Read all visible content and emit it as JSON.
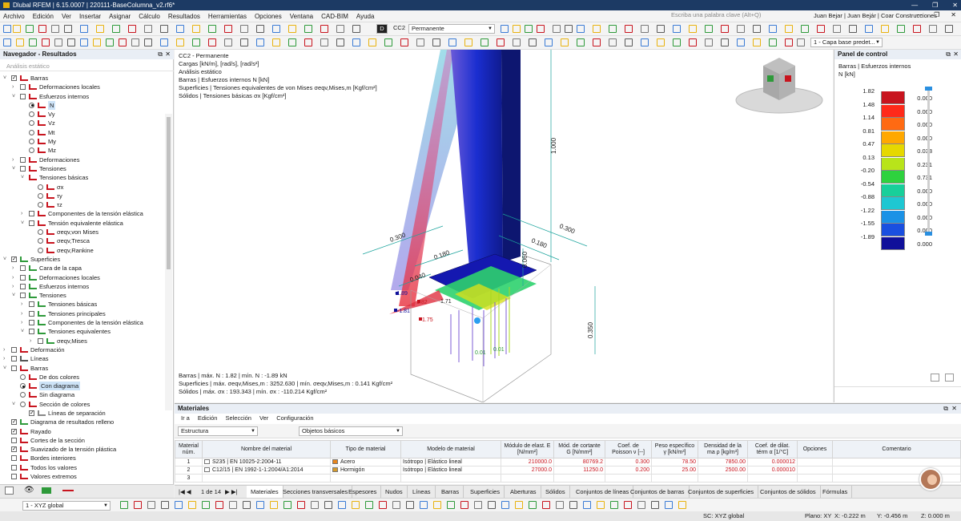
{
  "window": {
    "title": "Dlubal RFEM | 6.15.0007 | 220111-BaseColumna_v2.rf6*",
    "controls": [
      "—",
      "❐",
      "✕"
    ]
  },
  "menubar": {
    "items": [
      "Archivo",
      "Edición",
      "Ver",
      "Insertar",
      "Asignar",
      "Cálculo",
      "Resultados",
      "Herramientas",
      "Opciones",
      "Ventana",
      "CAD-BIM",
      "Ayuda"
    ],
    "search_placeholder": "Escriba una palabra clave (Alt+Q)",
    "user": "Juan Bejar | Juan Bejár | Coar Construcciones"
  },
  "toolbar": {
    "load_case_tag": "D",
    "load_case_id": "CC2",
    "load_case_name": "Permanente",
    "layer_combo": "1 - Capa base predet..."
  },
  "navigator": {
    "title": "Navegador - Resultados",
    "analysis": "Análisis estático",
    "items": [
      {
        "label": "Barras",
        "lvl": 0,
        "exp": "˅",
        "cb": "on",
        "ic": "#c8141e"
      },
      {
        "label": "Deformaciones locales",
        "lvl": 1,
        "exp": "›",
        "cb": "",
        "ic": "#c8141e"
      },
      {
        "label": "Esfuerzos internos",
        "lvl": 1,
        "exp": "˅",
        "cb": "",
        "ic": "#c8141e"
      },
      {
        "label": "N",
        "lvl": 2,
        "rb": "on",
        "ic": "#c8141e",
        "sel": true
      },
      {
        "label": "Vy",
        "lvl": 2,
        "rb": "",
        "ic": "#c8141e"
      },
      {
        "label": "Vz",
        "lvl": 2,
        "rb": "",
        "ic": "#c8141e"
      },
      {
        "label": "Mt",
        "lvl": 2,
        "rb": "",
        "ic": "#c8141e"
      },
      {
        "label": "My",
        "lvl": 2,
        "rb": "",
        "ic": "#c8141e"
      },
      {
        "label": "Mz",
        "lvl": 2,
        "rb": "",
        "ic": "#c8141e"
      },
      {
        "label": "Deformaciones",
        "lvl": 1,
        "exp": "›",
        "cb": "",
        "ic": "#c8141e"
      },
      {
        "label": "Tensiones",
        "lvl": 1,
        "exp": "˅",
        "cb": "",
        "ic": "#c8141e"
      },
      {
        "label": "Tensiones básicas",
        "lvl": 2,
        "exp": "˅",
        "ic": "#c8141e"
      },
      {
        "label": "σx",
        "lvl": 3,
        "rb": "",
        "ic": "#c8141e"
      },
      {
        "label": "τy",
        "lvl": 3,
        "rb": "",
        "ic": "#c8141e"
      },
      {
        "label": "τz",
        "lvl": 3,
        "rb": "",
        "ic": "#c8141e"
      },
      {
        "label": "Componentes de la tensión elástica",
        "lvl": 2,
        "exp": "›",
        "cb": "",
        "ic": "#c8141e"
      },
      {
        "label": "Tensión equivalente elástica",
        "lvl": 2,
        "exp": "˅",
        "cb": "",
        "ic": "#c8141e"
      },
      {
        "label": "σeqv,von Mises",
        "lvl": 3,
        "rb": "",
        "ic": "#c8141e"
      },
      {
        "label": "σeqv,Tresca",
        "lvl": 3,
        "rb": "",
        "ic": "#c8141e"
      },
      {
        "label": "σeqv,Rankine",
        "lvl": 3,
        "rb": "",
        "ic": "#c8141e"
      },
      {
        "label": "Superficies",
        "lvl": 0,
        "exp": "˅",
        "cb": "on",
        "ic": "#2e9a3a"
      },
      {
        "label": "Cara de la capa",
        "lvl": 1,
        "exp": "›",
        "cb": "",
        "ic": "#2e9a3a"
      },
      {
        "label": "Deformaciones locales",
        "lvl": 1,
        "exp": "›",
        "cb": "",
        "ic": "#2e9a3a"
      },
      {
        "label": "Esfuerzos internos",
        "lvl": 1,
        "exp": "›",
        "cb": "",
        "ic": "#2e9a3a"
      },
      {
        "label": "Tensiones",
        "lvl": 1,
        "exp": "˅",
        "cb": "",
        "ic": "#2e9a3a"
      },
      {
        "label": "Tensiones básicas",
        "lvl": 2,
        "exp": "›",
        "cb": "",
        "ic": "#2e9a3a"
      },
      {
        "label": "Tensiones principales",
        "lvl": 2,
        "exp": "›",
        "cb": "",
        "ic": "#2e9a3a"
      },
      {
        "label": "Componentes de la tensión elástica",
        "lvl": 2,
        "exp": "›",
        "cb": "",
        "ic": "#2e9a3a"
      },
      {
        "label": "Tensiones equivalentes",
        "lvl": 2,
        "exp": "˅",
        "cb": "",
        "ic": "#2e9a3a"
      },
      {
        "label": "σeqv,Mises",
        "lvl": 3,
        "exp": "›",
        "cb": "",
        "ic": "#2e9a3a"
      },
      {
        "label": "Deformación",
        "lvl": 0,
        "exp": "›",
        "cb": "",
        "ic": "#c8141e"
      },
      {
        "label": "Líneas",
        "lvl": 0,
        "exp": "›",
        "cb": "",
        "ic": "#555"
      },
      {
        "label": "Barras",
        "lvl": 0,
        "exp": "˅",
        "cb": "",
        "ic": "#c8141e"
      },
      {
        "label": "De dos colores",
        "lvl": 1,
        "rb": "",
        "ic": "#c8141e"
      },
      {
        "label": "Con diagrama",
        "lvl": 1,
        "rb": "on",
        "ic": "#c8141e",
        "sel": true
      },
      {
        "label": "Sin diagrama",
        "lvl": 1,
        "rb": "",
        "ic": "#c8141e"
      },
      {
        "label": "Sección de colores",
        "lvl": 1,
        "exp": "˅",
        "rb": "",
        "ic": "#c8141e"
      },
      {
        "label": "Líneas de separación",
        "lvl": 2,
        "cb": "on",
        "ic": "#888"
      },
      {
        "label": "Diagrama de resultados relleno",
        "lvl": 0,
        "cb": "on",
        "ic": "#2e9a3a"
      },
      {
        "label": "Rayado",
        "lvl": 0,
        "cb": "on",
        "ic": "#c8141e"
      },
      {
        "label": "Cortes de la sección",
        "lvl": 0,
        "cb": "",
        "ic": "#c8141e"
      },
      {
        "label": "Suavizado de la tensión plástica",
        "lvl": 0,
        "cb": "on",
        "ic": "#c8141e"
      },
      {
        "label": "Bordes interiores",
        "lvl": 0,
        "cb": "",
        "ic": "#c8141e"
      },
      {
        "label": "Todos los valores",
        "lvl": 0,
        "cb": "",
        "ic": "#c8141e"
      },
      {
        "label": "Valores extremos",
        "lvl": 0,
        "cb": "",
        "ic": "#c8141e"
      }
    ]
  },
  "viewport": {
    "header": [
      "CC2 - Permanente",
      "Cargas [kN/m], [rad/s], [rad/s²]",
      "Análisis estático",
      "Barras | Esfuerzos internos N [kN]",
      "Superficies | Tensiones equivalentes de von Mises σeqv,Mises,m [Kgf/cm²]",
      "Sólidos | Tensiones básicas σx [Kgf/cm²]"
    ],
    "footer": [
      "Barras | máx. N : 1.82 | mín. N : -1.89 kN",
      "Superficies | máx. σeqv,Mises,m : 3252.630 | mín. σeqv,Mises,m : 0.141 Kgf/cm²",
      "Sólidos | máx. σx : 193.343 | mín. σx : -110.214 Kgf/cm²"
    ],
    "dimensions": [
      "1.000",
      "0.300",
      "0.180",
      "0.040",
      "0.300",
      "0.180",
      "0.060",
      "0.350"
    ],
    "labels": [
      "-1.89",
      "-1.81",
      "1.82",
      "1.75",
      "1.71",
      "0.01"
    ]
  },
  "control_panel": {
    "title": "Panel de control",
    "subtitle": "Barras | Esfuerzos internos",
    "unit": "N [kN]",
    "legend": [
      {
        "value": "1.82",
        "pct": "0.000",
        "color": "#c8141e"
      },
      {
        "value": "1.48",
        "pct": "0.000",
        "color": "#ff2a1a"
      },
      {
        "value": "1.14",
        "pct": "0.000",
        "color": "#ff6a12"
      },
      {
        "value": "0.81",
        "pct": "0.000",
        "color": "#ffa800"
      },
      {
        "value": "0.47",
        "pct": "0.038",
        "color": "#e6d800"
      },
      {
        "value": "0.13",
        "pct": "0.231",
        "color": "#b8e41a"
      },
      {
        "value": "-0.20",
        "pct": "0.731",
        "color": "#2ed23e"
      },
      {
        "value": "-0.54",
        "pct": "0.000",
        "color": "#18cf9a"
      },
      {
        "value": "-0.88",
        "pct": "0.000",
        "color": "#1ec7d2"
      },
      {
        "value": "-1.22",
        "pct": "0.000",
        "color": "#1b92e6"
      },
      {
        "value": "-1.55",
        "pct": "0.000",
        "color": "#1a4fe0"
      },
      {
        "value": "-1.89",
        "pct": "0.000",
        "color": "#10109a"
      }
    ]
  },
  "materials": {
    "title": "Materiales",
    "menu": [
      "Ir a",
      "Edición",
      "Selección",
      "Ver",
      "Configuración"
    ],
    "filter1": "Estructura",
    "filter2": "Objetos básicos",
    "columns": [
      "Material núm.",
      "Nombre del material",
      "Tipo de material",
      "Modelo de material",
      "Módulo de elast. E [N/mm²]",
      "Mód. de cortante G [N/mm²]",
      "Coef. de Poisson ν [--]",
      "Peso específico γ [kN/m³]",
      "Densidad de la ma ρ [kg/m³]",
      "Coef. de dilat. térm α [1/°C]",
      "Opciones",
      "Comentario"
    ],
    "rows": [
      {
        "n": "1",
        "name": "S235 | EN 10025-2:2004-11",
        "type": "Acero",
        "type_color": "#e8841a",
        "model": "Isótropo | Elástico lineal",
        "E": "210000.0",
        "G": "80769.2",
        "nu": "0.300",
        "gamma": "78.50",
        "rho": "7850.00",
        "alpha": "0.000012"
      },
      {
        "n": "2",
        "name": "C12/15 | EN 1992-1-1:2004/A1:2014",
        "type": "Hormigón",
        "type_color": "#d59a2c",
        "model": "Isótropo | Elástico lineal",
        "E": "27000.0",
        "G": "11250.0",
        "nu": "0.200",
        "gamma": "25.00",
        "rho": "2500.00",
        "alpha": "0.000010"
      },
      {
        "n": "3",
        "name": "",
        "type": "",
        "type_color": "",
        "model": "",
        "E": "",
        "G": "",
        "nu": "",
        "gamma": "",
        "rho": "",
        "alpha": ""
      }
    ]
  },
  "tabs": {
    "pager": "1 de 14",
    "items": [
      "Materiales",
      "Secciones transversales",
      "Espesores",
      "Nudos",
      "Líneas",
      "Barras",
      "Superficies",
      "Aberturas",
      "Sólidos",
      "Conjuntos de líneas",
      "Conjuntos de barras",
      "Conjuntos de superficies",
      "Conjuntos de sólidos",
      "Fórmulas"
    ]
  },
  "status": {
    "coord_system": "1 - XYZ global",
    "sc": "SC: XYZ global",
    "plane": "Plano: XY",
    "x": "X: -0.222 m",
    "y": "Y: -0.456 m",
    "z": "Z: 0.000 m"
  }
}
